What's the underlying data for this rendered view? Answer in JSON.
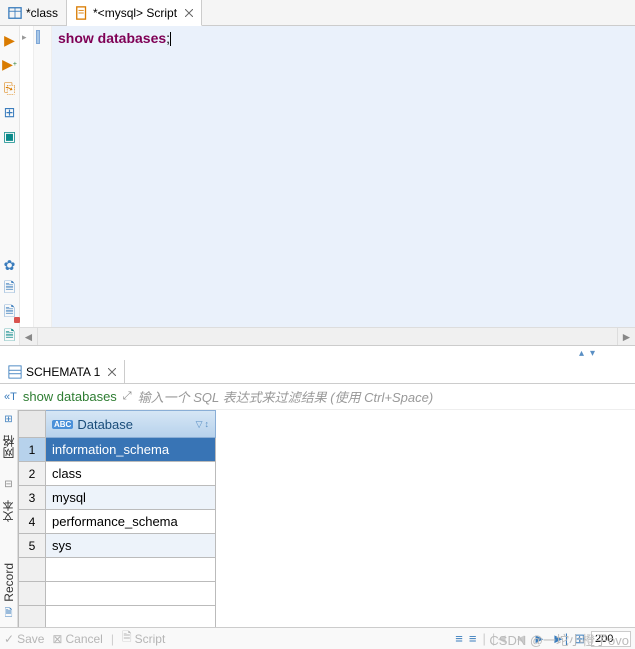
{
  "tabs": [
    {
      "label": "*class",
      "icon": "table"
    },
    {
      "label": "*<mysql> Script",
      "icon": "sql"
    }
  ],
  "editor": {
    "code_keyword": "show databases",
    "code_punct": ";"
  },
  "toolbar": {
    "items": [
      "run",
      "run-plus",
      "run-script",
      "plan",
      "stop"
    ],
    "items2": [
      "settings",
      "file-new",
      "file-red",
      "file-teal"
    ]
  },
  "bottom_tabs": [
    {
      "label": "SCHEMATA 1"
    }
  ],
  "filter": {
    "query_label": "show databases",
    "placeholder": "输入一个 SQL 表达式来过滤结果 (使用 Ctrl+Space)"
  },
  "side_labels": {
    "top": "网格",
    "bottom": "Record"
  },
  "grid": {
    "column_header": "Database",
    "abc_badge": "ABC",
    "rows": [
      {
        "num": "1",
        "value": "information_schema",
        "selected": true
      },
      {
        "num": "2",
        "value": "class"
      },
      {
        "num": "3",
        "value": "mysql",
        "alt": true
      },
      {
        "num": "4",
        "value": "performance_schema"
      },
      {
        "num": "5",
        "value": "sys",
        "alt": true
      }
    ]
  },
  "footer": {
    "save": "Save",
    "cancel": "Cancel",
    "script": "Script",
    "page_value": "200"
  },
  "watermark": "CSDN @一坨小橙子ovo"
}
